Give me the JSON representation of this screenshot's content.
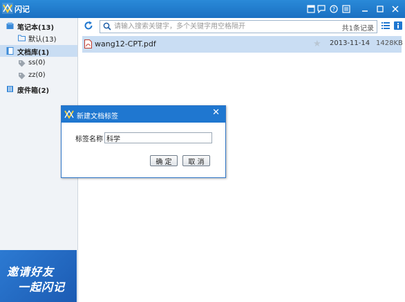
{
  "app": {
    "title": "闪记"
  },
  "titlebar_buttons": [
    {
      "icon": "window-icon"
    },
    {
      "icon": "chat-icon"
    },
    {
      "icon": "help-icon"
    },
    {
      "icon": "menu-icon"
    }
  ],
  "sidebar": {
    "items": [
      {
        "label": "笔记本(13)",
        "icon": "notebook-icon",
        "selected": false
      },
      {
        "label": "默认(13)",
        "icon": "folder-icon",
        "selected": false
      },
      {
        "label": "文档库(1)",
        "icon": "document-icon",
        "selected": true
      },
      {
        "label": "ss(0)",
        "icon": "tag-icon",
        "selected": false
      },
      {
        "label": "zz(0)",
        "icon": "tag-icon",
        "selected": false
      },
      {
        "label": "废件箱(2)",
        "icon": "trash-icon",
        "selected": false
      }
    ],
    "promo": {
      "line1": "邀请好友",
      "line2": "一起闪记"
    }
  },
  "toolbar": {
    "search_placeholder": "请输入搜索关键字，多个关键字用空格隔开",
    "count": "共1条记录"
  },
  "files": [
    {
      "name": "wang12-CPT.pdf",
      "date": "2013-11-14",
      "size": "1428KB",
      "icon": "pdf-icon"
    }
  ],
  "dialog": {
    "title": "新建文档标签",
    "label": "标签名称",
    "value": "科学",
    "confirm": "确 定",
    "cancel": "取 消"
  },
  "colors": {
    "titlebar": "#1a70c2",
    "selection": "#c9ddf3",
    "dialog_title": "#1f77d0"
  }
}
